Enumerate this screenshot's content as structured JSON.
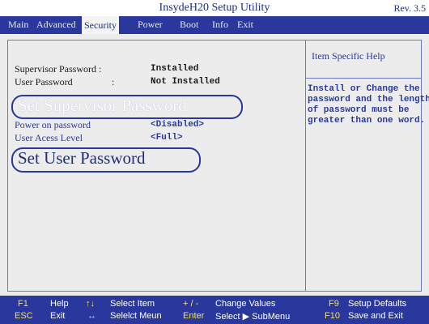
{
  "window": {
    "title": "InsydeH20 Setup Utility",
    "revision": "Rev. 3.5"
  },
  "menu": {
    "items": [
      "Main",
      "Advanced",
      "Security",
      "Power",
      "Boot",
      "Info",
      "Exit"
    ],
    "active": "Security"
  },
  "settings": {
    "supervisor_password": {
      "label": "Supervisor Password :",
      "value": "Installed"
    },
    "user_password": {
      "label": "User Password",
      "colon": ":",
      "value": "Not Installed"
    },
    "set_supervisor_password": {
      "label": "Set Supervisor Password"
    },
    "power_on_password": {
      "label": "Power on password",
      "value": "<Disabled>"
    },
    "user_access_level": {
      "label": "User Acess Level",
      "value": "<Full>"
    },
    "set_user_password": {
      "label": "Set User Password"
    }
  },
  "help": {
    "title": "Item Specific Help",
    "body": "Install or Change the\npassword and the length\nof password must be\ngreater than one word."
  },
  "statusbar": {
    "items": [
      {
        "key": "F1",
        "desc": "Help"
      },
      {
        "key": "↑↓",
        "desc": "Select Item"
      },
      {
        "key": "+ / -",
        "desc": "Change Values"
      },
      {
        "key": "F9",
        "desc": "Setup Defaults"
      },
      {
        "key": "ESC",
        "desc": "Exit"
      },
      {
        "key": "↔",
        "desc": "Selelct Meun"
      },
      {
        "key": "Enter",
        "desc": "Select ▶ SubMenu"
      },
      {
        "key": "F10",
        "desc": "Save and Exit"
      }
    ]
  },
  "colors": {
    "menubar": "#2a389e",
    "background": "#ececec",
    "accent_text": "#1f2f78",
    "status_key": "#f2e15a",
    "callout_border": "#2a389e"
  }
}
